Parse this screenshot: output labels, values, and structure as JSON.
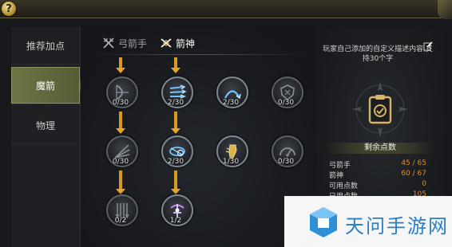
{
  "header": {
    "help_symbol": "?"
  },
  "left_tabs": [
    {
      "label": "推荐加点",
      "active": false
    },
    {
      "label": "魔箭",
      "active": true
    },
    {
      "label": "物理",
      "active": false
    }
  ],
  "sub_tabs": [
    {
      "label": "弓箭手",
      "icon": "crossed-bows-icon",
      "active": false
    },
    {
      "label": "箭神",
      "icon": "arrow-god-icon",
      "active": true
    }
  ],
  "skill_nodes": [
    {
      "icon": "bow-draw-icon",
      "points": "0/30",
      "lit": false
    },
    {
      "icon": "triple-arrow-icon",
      "points": "2/30",
      "lit": true
    },
    {
      "icon": "arc-up-arrow-icon",
      "points": "2/30",
      "lit": true
    },
    {
      "icon": "shield-crest-icon",
      "points": "0/30",
      "lit": false
    },
    {
      "icon": "fan-arrows-icon",
      "points": "0/30",
      "lit": false
    },
    {
      "icon": "whirlwind-arrow-icon",
      "points": "2/30",
      "lit": true
    },
    {
      "icon": "golden-fist-icon",
      "points": "1/30",
      "lit": true
    },
    {
      "icon": "speed-gauge-icon",
      "points": "0/30",
      "lit": false
    },
    {
      "icon": "arrow-rain-icon",
      "points": "0/2",
      "lit": false
    },
    {
      "icon": "spirit-bow-icon",
      "points": "1/2",
      "lit": true
    }
  ],
  "right_panel": {
    "description": "玩家自己添加的自定义描述内容,支持30个字",
    "remaining_title": "剩余点数",
    "stats": [
      {
        "label": "弓箭手",
        "value": "45 / 65"
      },
      {
        "label": "箭神",
        "value": "60 / 67"
      },
      {
        "label": "可用点数",
        "value": "0"
      },
      {
        "label": "已用点数",
        "value": "105"
      }
    ]
  },
  "watermark": {
    "text": "天问手游网"
  },
  "colors": {
    "accent_gold": "#d79b24",
    "active_tab": "#6c7645",
    "value_orange": "#e38a2a",
    "watermark_blue": "#2a7ec2"
  }
}
